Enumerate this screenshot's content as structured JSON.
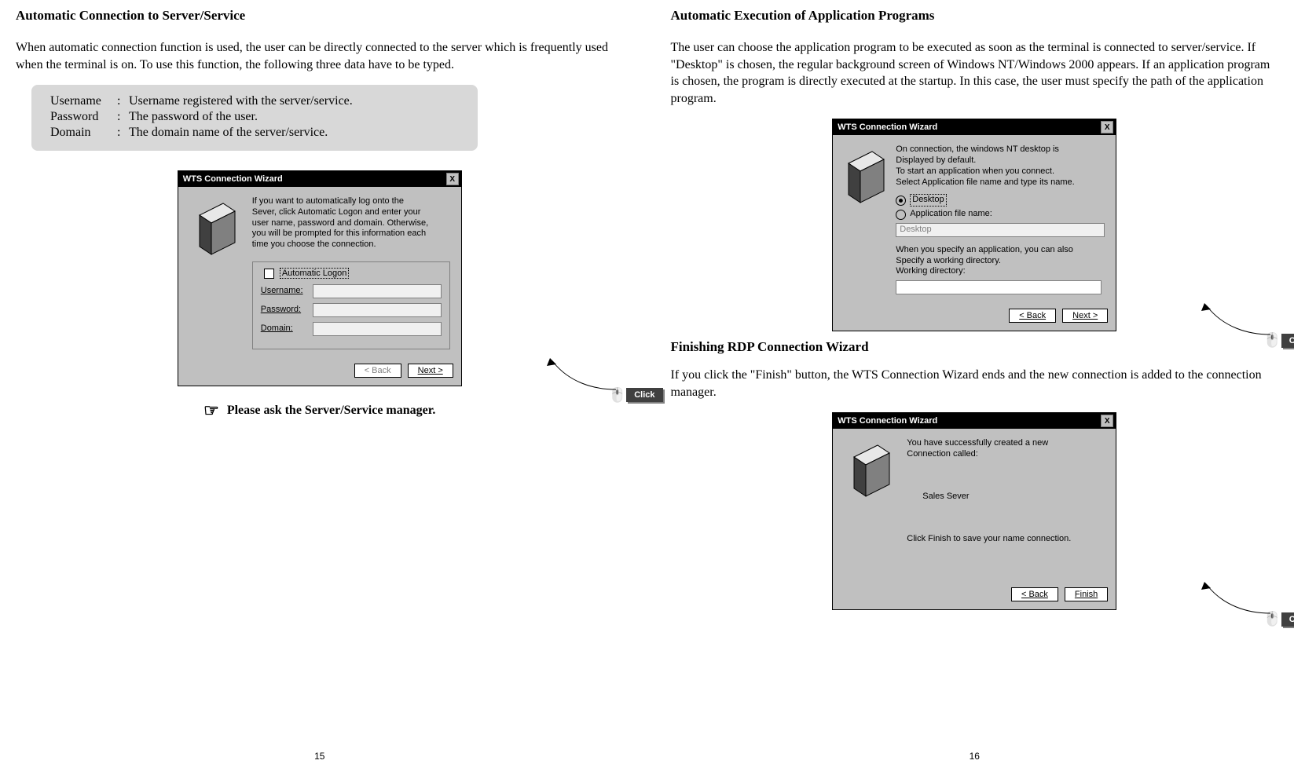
{
  "left": {
    "heading": "Automatic Connection to Server/Service",
    "intro": "When automatic connection function is used, the user can be directly connected to the server which is frequently used when the terminal is on. To use this function, the following three data have to be typed.",
    "info": {
      "r1_label": "Username",
      "r1_value": "Username registered with the server/service.",
      "r2_label": "Password",
      "r2_value": "The password of the user.",
      "r3_label": "Domain",
      "r3_value": "The domain name of the server/service."
    },
    "wizard": {
      "title": "WTS Connection Wizard",
      "desc_l1": "If you want to automatically log onto the",
      "desc_l2": "Sever, click Automatic Logon and enter your",
      "desc_l3": "user name, password and domain.  Otherwise,",
      "desc_l4": "you will be prompted for this information each",
      "desc_l5": "time you choose the connection.",
      "legend": "Automatic Logon",
      "username_label": "Username:",
      "password_label": "Password:",
      "domain_label": "Domain:",
      "back_btn": "< Back",
      "next_btn": "Next >"
    },
    "click_label": "Click",
    "note": "Please ask the Server/Service manager.",
    "pagenum": "15"
  },
  "right": {
    "heading": "Automatic Execution of Application Programs",
    "intro": "The user can choose the application program to be executed as soon as the terminal is connected to server/service. If \"Desktop\" is chosen, the regular background screen of Windows NT/Windows 2000 appears. If an application program is chosen, the program is directly executed at the startup. In this case, the user must specify the path of the application program.",
    "wizard1": {
      "title": "WTS Connection Wizard",
      "l1": "On connection, the windows NT desktop is",
      "l2": "Displayed by default.",
      "l3": "To start an application when you connect.",
      "l4": "Select Application file name and type its name.",
      "opt_desktop": "Desktop",
      "opt_app": "Application file name:",
      "app_placeholder": "Desktop",
      "l5": "When you specify an application, you can also",
      "l6": "Specify a working directory.",
      "l7": "Working directory:",
      "back_btn": "< Back",
      "next_btn": "Next >"
    },
    "click_label": "Click",
    "heading2": "Finishing RDP Connection Wizard",
    "para2": "If you click the \"Finish\" button, the WTS Connection Wizard ends and the new connection is added to the connection manager.",
    "wizard2": {
      "title": "WTS Connection Wizard",
      "l1": "You have successfully created a new",
      "l2": "Connection called:",
      "conn_name": "Sales Sever",
      "l3": "Click Finish to save your name connection.",
      "back_btn": "< Back",
      "finish_btn": "Finish"
    },
    "pagenum": "16"
  }
}
